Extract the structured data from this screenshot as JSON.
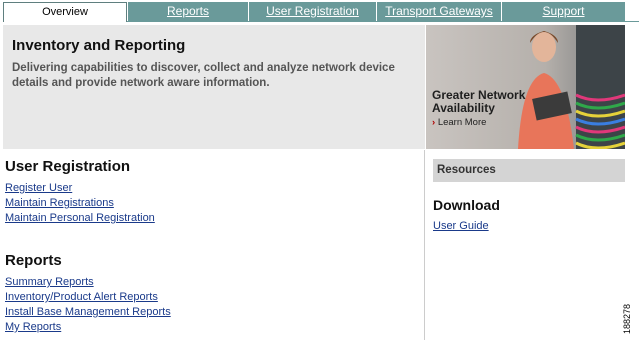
{
  "tabs": [
    {
      "label": "Overview",
      "active": true
    },
    {
      "label": "Reports",
      "active": false
    },
    {
      "label": "User Registration",
      "active": false
    },
    {
      "label": "Transport Gateways",
      "active": false
    },
    {
      "label": "Support",
      "active": false
    }
  ],
  "hero": {
    "title": "Inventory and Reporting",
    "description": "Delivering capabilities to discover, collect and analyze network device details and provide network aware information."
  },
  "promo": {
    "title_line1": "Greater Network",
    "title_line2": "Availability",
    "learn_more": "Learn More"
  },
  "user_registration": {
    "title": "User Registration",
    "links": [
      "Register User",
      "Maintain Registrations",
      "Maintain Personal Registration"
    ]
  },
  "reports": {
    "title": "Reports",
    "links": [
      "Summary Reports",
      "Inventory/Product Alert Reports",
      "Install Base Management Reports",
      "My Reports"
    ]
  },
  "resources": {
    "header": "Resources",
    "download_title": "Download",
    "user_guide": "User Guide"
  },
  "figure_id": "188278",
  "colors": {
    "tab_bg": "#6a9a9a",
    "hero_bg": "#e8e8e8",
    "link": "#1a3a8a"
  }
}
